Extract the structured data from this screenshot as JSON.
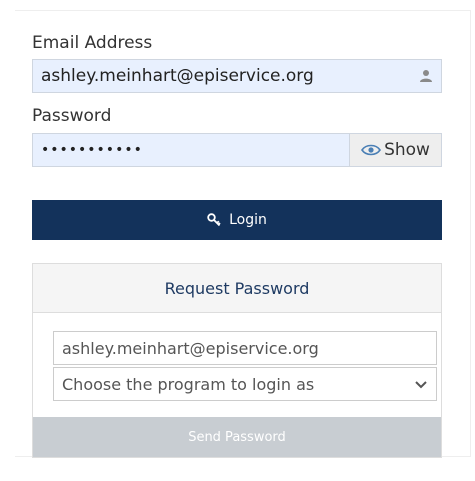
{
  "login": {
    "email_label": "Email Address",
    "email_value": "ashley.meinhart@episervice.org",
    "password_label": "Password",
    "password_value": "•••••••••••",
    "show_label": "Show",
    "login_label": "Login"
  },
  "request": {
    "title": "Request Password",
    "email_value": "ashley.meinhart@episervice.org",
    "program_select": "Choose the program to login as",
    "send_label": "Send Password"
  },
  "colors": {
    "login_button": "#13325b",
    "autofill_bg": "#e8f0fe",
    "send_disabled": "#c8cdd2",
    "header_text": "#1f3b63"
  },
  "icons": {
    "email_addon": "user-icon",
    "show": "eye-icon",
    "login": "key-icon",
    "select": "chevron-down-icon"
  }
}
